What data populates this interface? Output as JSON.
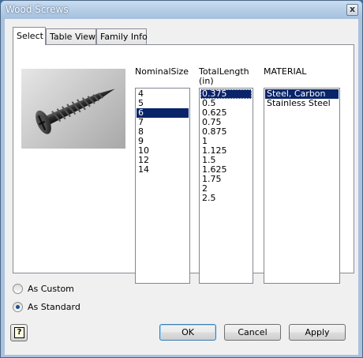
{
  "window": {
    "title": "Wood Screws",
    "close_glyph": "x"
  },
  "tabs": [
    {
      "label": "Select",
      "active": true
    },
    {
      "label": "Table View",
      "active": false
    },
    {
      "label": "Family Info",
      "active": false
    }
  ],
  "columns": {
    "nominal_size": {
      "header": "NominalSize",
      "items": [
        "4",
        "5",
        "6",
        "7",
        "8",
        "9",
        "10",
        "12",
        "14"
      ],
      "selected": "6"
    },
    "total_length": {
      "header_line1": "TotalLength",
      "header_line2": "(in)",
      "items": [
        "0.375",
        "0.5",
        "0.625",
        "0.75",
        "0.875",
        "1",
        "1.125",
        "1.5",
        "1.625",
        "1.75",
        "2",
        "2.5"
      ],
      "selected": "0.375"
    },
    "material": {
      "header": "MATERIAL",
      "items": [
        "Steel, Carbon",
        "Stainless Steel"
      ],
      "selected": "Steel, Carbon"
    }
  },
  "options": {
    "as_custom": {
      "label": "As Custom",
      "checked": false
    },
    "as_standard": {
      "label": "As Standard",
      "checked": true
    }
  },
  "buttons": {
    "help": "?",
    "ok": "OK",
    "cancel": "Cancel",
    "apply": "Apply"
  },
  "colors": {
    "selection": "#0a246a",
    "titlebar": "#a9c2dd"
  }
}
